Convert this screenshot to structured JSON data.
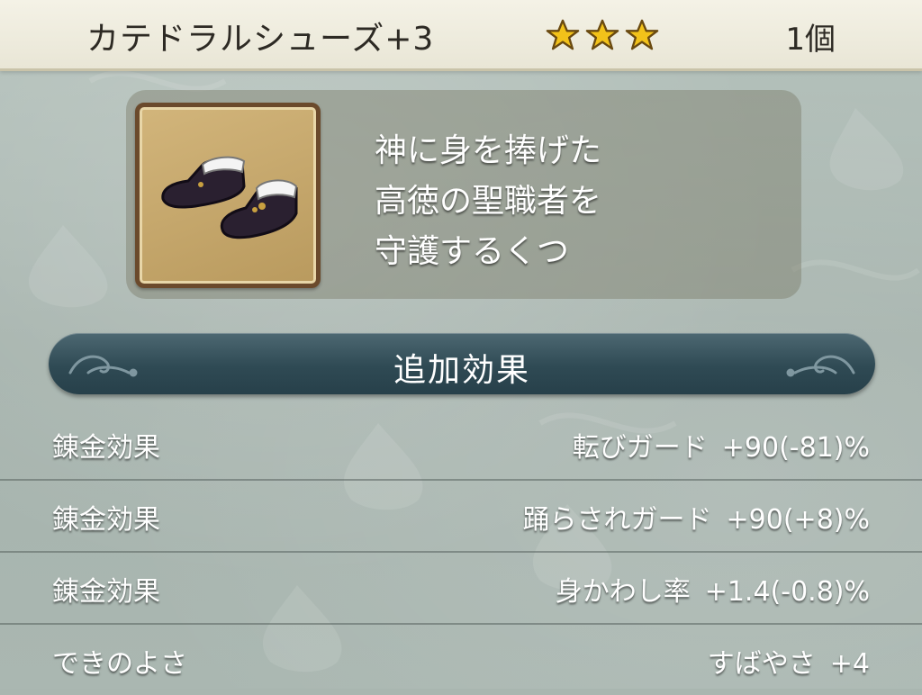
{
  "item": {
    "name": "カテドラルシューズ+3",
    "quantity": "1個",
    "rarity_stars": 3,
    "icon": "shoes-icon",
    "description": [
      "神に身を捧げた",
      "高徳の聖職者を",
      "守護するくつ"
    ]
  },
  "section": {
    "title": "追加効果"
  },
  "effects": [
    {
      "label": "錬金効果",
      "name": "転びガード",
      "value": "+90(-81)%"
    },
    {
      "label": "錬金効果",
      "name": "踊らされガード",
      "value": "+90(+8)%"
    },
    {
      "label": "錬金効果",
      "name": "身かわし率",
      "value": "+1.4(-0.8)%"
    },
    {
      "label": "できのよさ",
      "name": "すばやさ",
      "value": "+4"
    }
  ],
  "colors": {
    "star": "#f2c21a",
    "banner": "#2f4a54",
    "header": "#f1efe2"
  }
}
